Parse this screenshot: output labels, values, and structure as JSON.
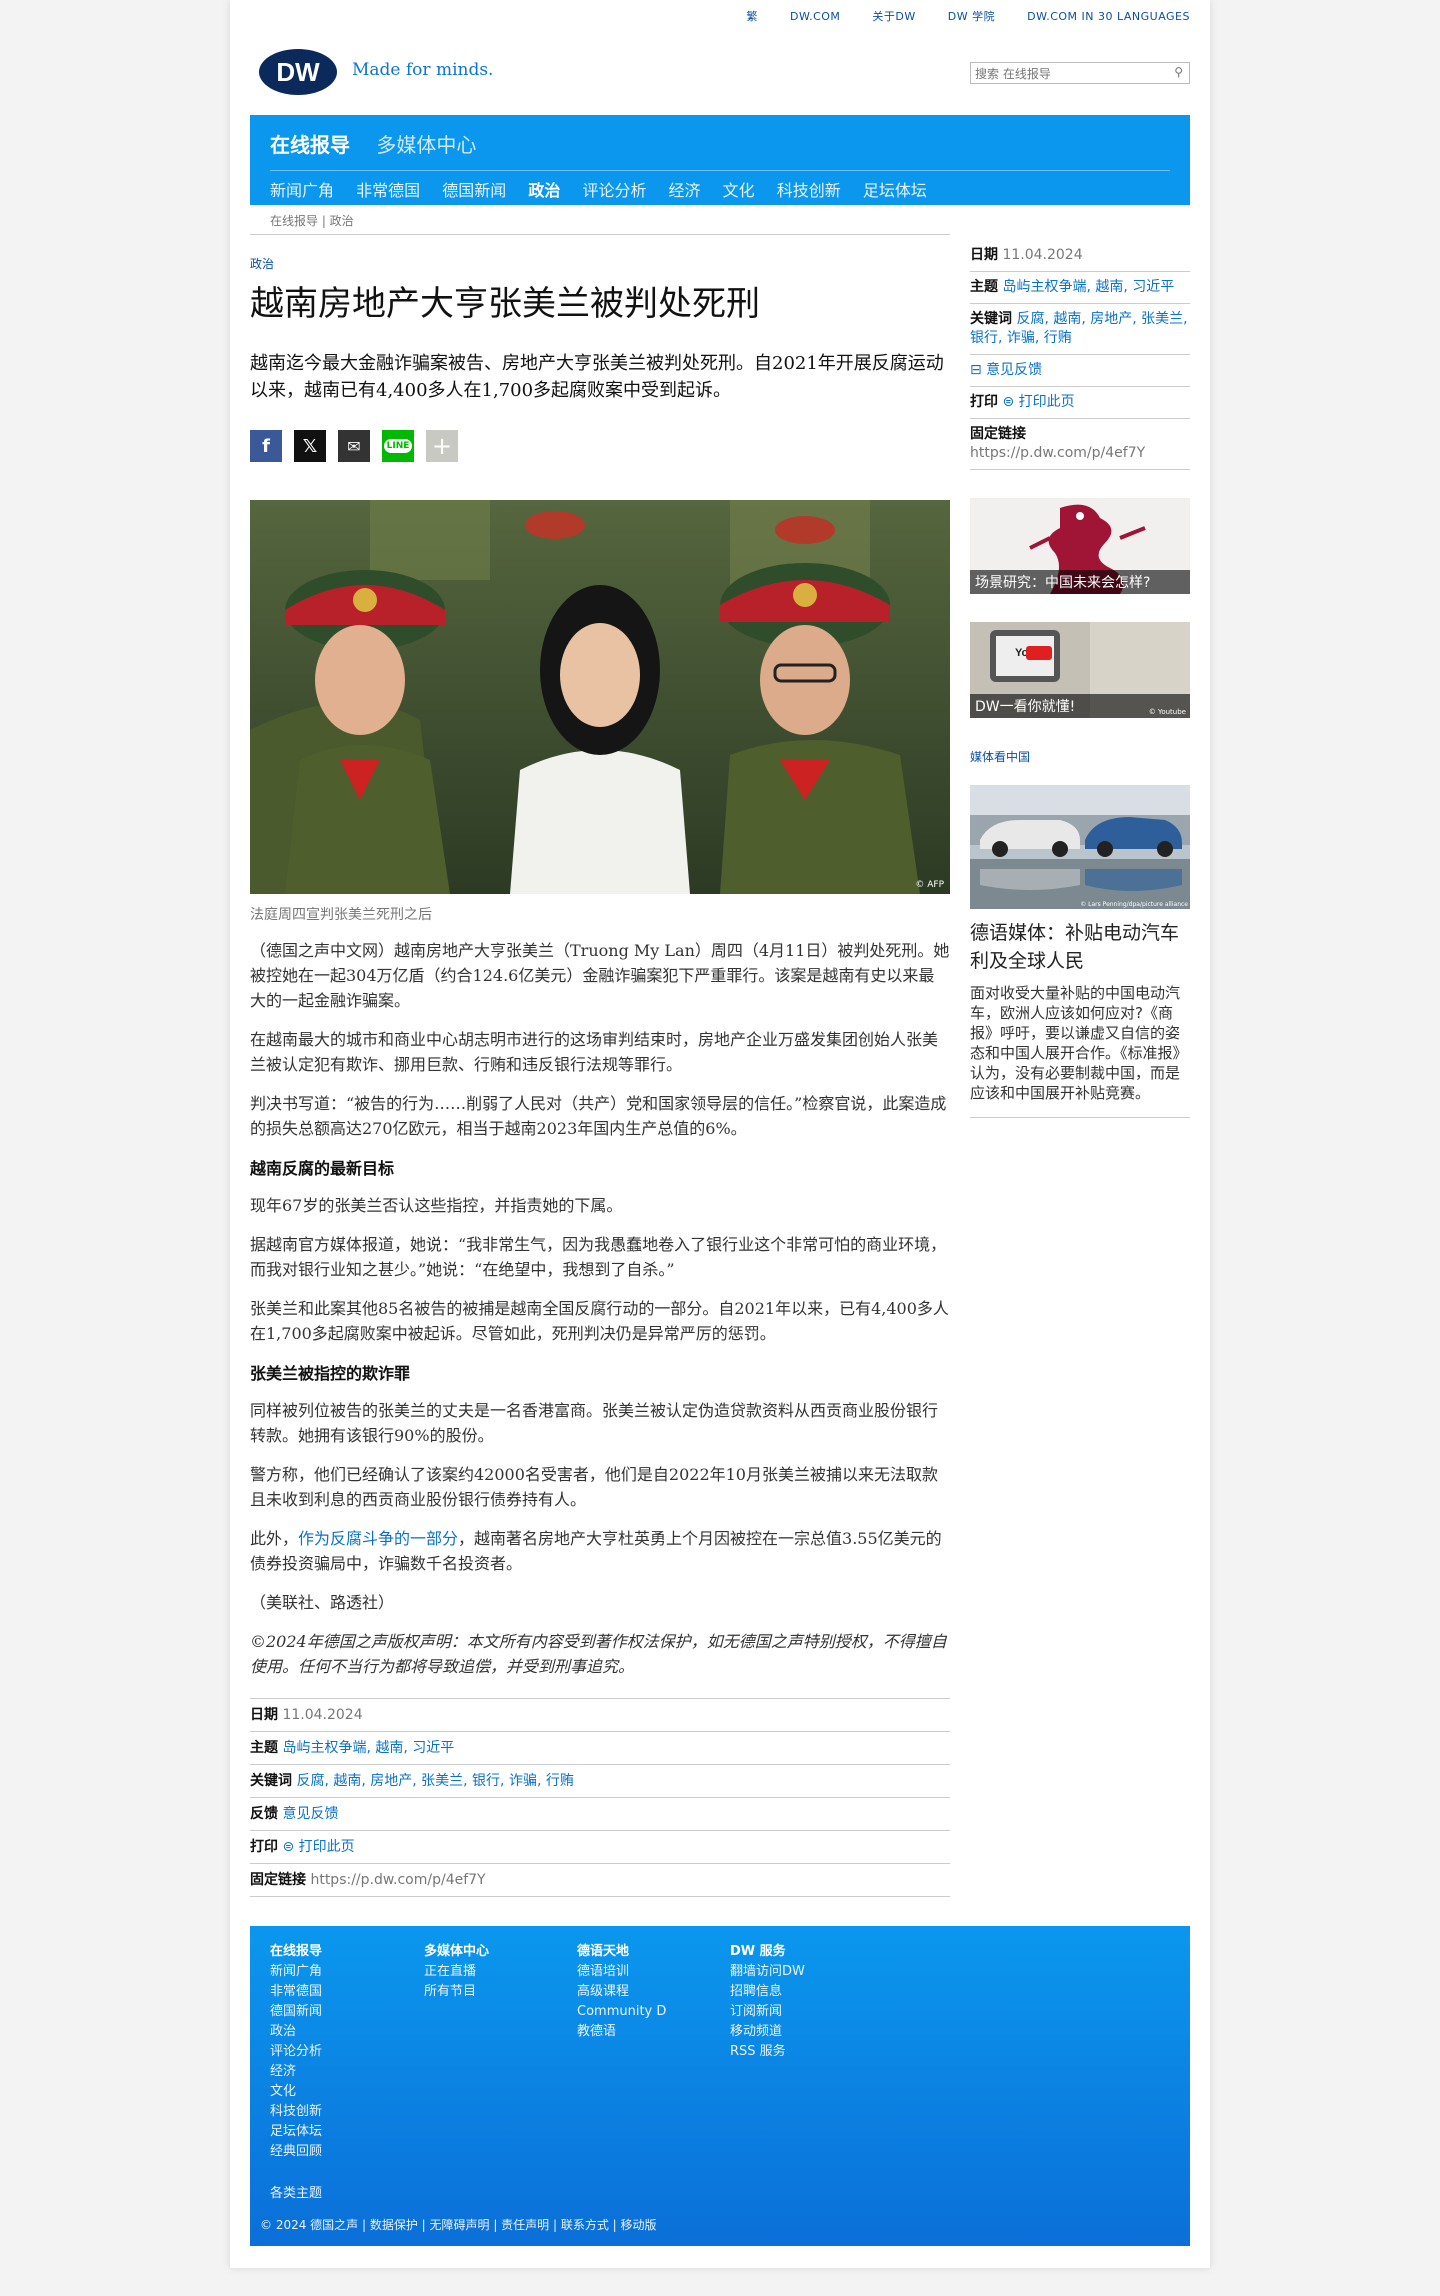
{
  "topbar": {
    "items": [
      "繁",
      "DW.COM",
      "关于DW",
      "DW 学院",
      "DW.COM IN 30 LANGUAGES"
    ]
  },
  "brand": {
    "logo": "DW",
    "tagline": "Made for minds."
  },
  "search": {
    "placeholder": "搜索 在线报导"
  },
  "mainnav": {
    "items": [
      "在线报导",
      "多媒体中心"
    ]
  },
  "subnav": {
    "items": [
      "新闻广角",
      "非常德国",
      "德国新闻",
      "政治",
      "评论分析",
      "经济",
      "文化",
      "科技创新",
      "足坛体坛"
    ]
  },
  "breadcrumb": "在线报导 | 政治",
  "article": {
    "kicker": "政治",
    "title": "越南房地产大亨张美兰被判处死刑",
    "lead": "越南迄今最大金融诈骗案被告、房地产大亨张美兰被判处死刑。自2021年开展反腐运动以来，越南已有4,400多人在1,700多起腐败案中受到起诉。",
    "image_credit": "© AFP",
    "caption": "法庭周四宣判张美兰死刑之后",
    "p1": "（德国之声中文网）越南房地产大亨张美兰（Truong My Lan）周四（4月11日）被判处死刑。她被控她在一起304万亿盾（约合124.6亿美元）金融诈骗案犯下严重罪行。该案是越南有史以来最大的一起金融诈骗案。",
    "p2": "在越南最大的城市和商业中心胡志明市进行的这场审判结束时，房地产企业万盛发集团创始人张美兰被认定犯有欺诈、挪用巨款、行贿和违反银行法规等罪行。",
    "p3": "判决书写道：“被告的行为……削弱了人民对（共产）党和国家领导层的信任。”检察官说，此案造成的损失总额高达270亿欧元，相当于越南2023年国内生产总值的6%。",
    "h_1": "越南反腐的最新目标",
    "p4": "现年67岁的张美兰否认这些指控，并指责她的下属。",
    "p5": "据越南官方媒体报道，她说：“我非常生气，因为我愚蠢地卷入了银行业这个非常可怕的商业环境，而我对银行业知之甚少。”她说：“在绝望中，我想到了自杀。”",
    "p6": "张美兰和此案其他85名被告的被捕是越南全国反腐行动的一部分。自2021年以来，已有4,400多人在1,700多起腐败案中被起诉。尽管如此，死刑判决仍是异常严厉的惩罚。",
    "h_2": "张美兰被指控的欺诈罪",
    "p7": "同样被列位被告的张美兰的丈夫是一名香港富商。张美兰被认定伪造贷款资料从西贡商业股份银行转款。她拥有该银行90%的股份。",
    "p8": "警方称，他们已经确认了该案约42000名受害者，他们是自2022年10月张美兰被捕以来无法取款且未收到利息的西贡商业股份银行债券持有人。",
    "p9_pre": "此外，",
    "p9_link": "作为反腐斗争的一部分",
    "p9_post": "，越南著名房地产大亨杜英勇上个月因被控在一宗总值3.55亿美元的债券投资骗局中，诈骗数千名投资者。",
    "source": "（美联社、路透社）",
    "copyright": "©2024年德国之声版权声明：本文所有内容受到著作权法保护，如无德国之声特别授权，不得擅自使用。任何不当行为都将导致追偿，并受到刑事追究。"
  },
  "meta": {
    "date_label": "日期",
    "date": "11.04.2024",
    "topic_label": "主题",
    "topics": "岛屿主权争端, 越南, 习近平",
    "keywords_label": "关键词",
    "keywords": "反腐, 越南, 房地产, 张美兰, 银行, 诈骗, 行贿",
    "feedback_label": "反馈",
    "feedback": "意见反馈",
    "feedback_link": "⊟ 意见反馈",
    "print_label": "打印",
    "print": "⊜ 打印此页",
    "permalink_label": "固定链接",
    "permalink": "https://p.dw.com/p/4ef7Y"
  },
  "sidebar": {
    "teaser1": "场景研究：中国未来会怎样?",
    "teaser2": "DW一看你就懂!",
    "teaser2_credit": "© Youtube",
    "media_label": "媒体看中国",
    "media_credit": "© Lars Penning/dpa/picture alliance",
    "media_title": "德语媒体：补贴电动汽车利及全球人民",
    "media_desc": "面对收受大量补贴的中国电动汽车，欧洲人应该如何应对?《商报》呼吁，要以谦虚又自信的姿态和中国人展开合作。《标准报》认为，没有必要制裁中国，而是应该和中国展开补贴竞赛。"
  },
  "footer": {
    "col1": {
      "title": "在线报导",
      "items": [
        "新闻广角",
        "非常德国",
        "德国新闻",
        "政治",
        "评论分析",
        "经济",
        "文化",
        "科技创新",
        "足坛体坛",
        "经典回顾"
      ]
    },
    "col2": {
      "title": "多媒体中心",
      "items": [
        "正在直播",
        "所有节目"
      ]
    },
    "col3": {
      "title": "德语天地",
      "items": [
        "德语培训",
        "高级课程",
        "Community D",
        "教德语"
      ]
    },
    "col4": {
      "title": "DW 服务",
      "items": [
        "翻墙访问DW",
        "招聘信息",
        "订阅新闻",
        "移动频道",
        "RSS 服务"
      ]
    },
    "extra": "各类主题",
    "copyright": "© 2024 德国之声 | 数据保护 | 无障碍声明 | 责任声明 | 联系方式 | 移动版"
  },
  "colors": {
    "brand_blue": "#0b97ee",
    "link_blue": "#0b72c9",
    "logo_navy": "#0b2a5b"
  }
}
